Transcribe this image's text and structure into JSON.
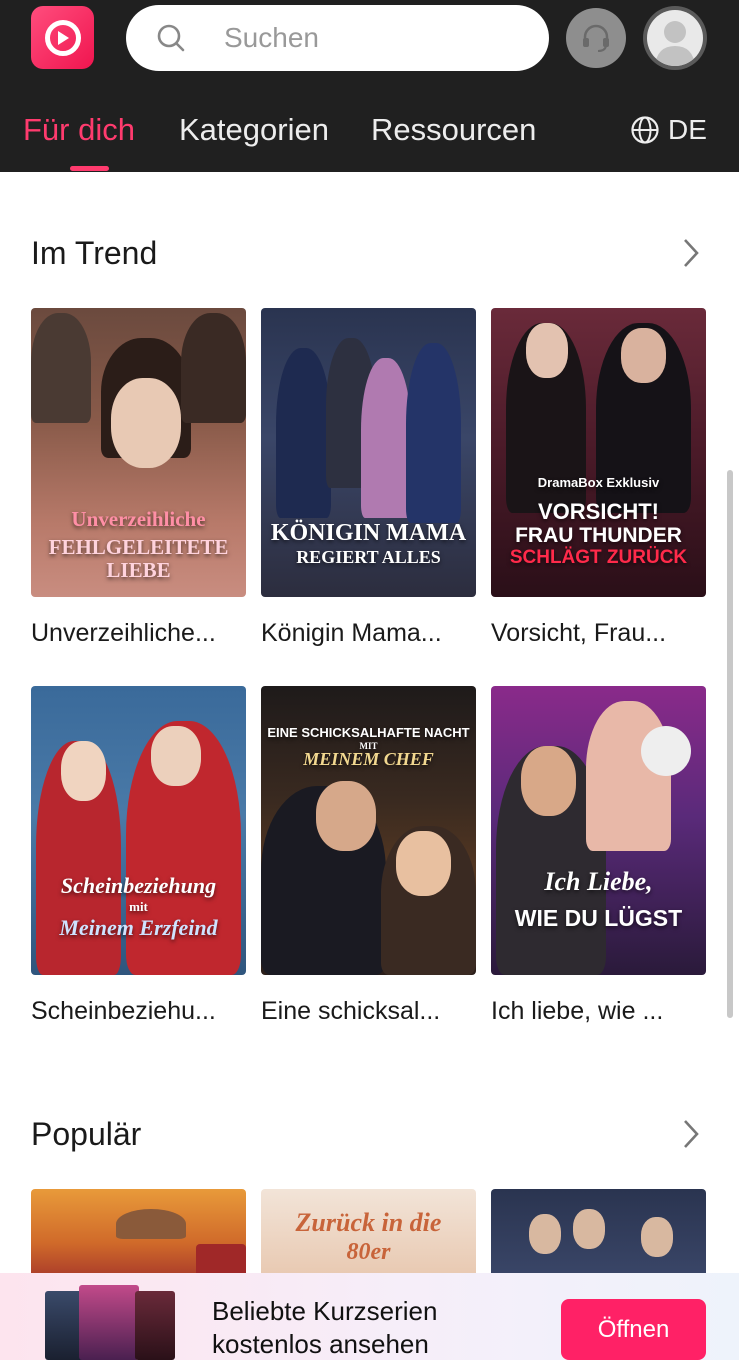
{
  "header": {
    "search_placeholder": "Suchen",
    "nav_tabs": [
      {
        "label": "Für dich",
        "active": true
      },
      {
        "label": "Kategorien",
        "active": false
      },
      {
        "label": "Ressourcen",
        "active": false
      }
    ],
    "language": "DE"
  },
  "colors": {
    "brand": "#ff3b6e",
    "header_bg": "#202020",
    "button": "#ff2166"
  },
  "trending": {
    "title": "Im Trend",
    "items": [
      {
        "title": "Unverzeihliche...",
        "poster_line1": "Unverzeihliche",
        "poster_line2": "FEHLGELEITETE LIEBE"
      },
      {
        "title": "Königin Mama...",
        "poster_line1": "KÖNIGIN MAMA",
        "poster_line2": "REGIERT ALLES"
      },
      {
        "title": "Vorsicht, Frau...",
        "poster_badge": "DramaBox Exklusiv",
        "poster_line1": "VORSICHT!",
        "poster_line2": "FRAU THUNDER",
        "poster_line3": "SCHLÄGT ZURÜCK"
      },
      {
        "title": "Scheinbeziehu...",
        "poster_line1": "Scheinbeziehung",
        "poster_line2": "mit",
        "poster_line3": "Meinem Erzfeind"
      },
      {
        "title": "Eine schicksal...",
        "poster_line1": "EINE SCHICKSALHAFTE NACHT",
        "poster_line2": "MIT",
        "poster_line3": "MEINEM CHEF"
      },
      {
        "title": "Ich liebe, wie ...",
        "poster_line1": "Ich Liebe,",
        "poster_line2": "WIE DU LÜGST"
      }
    ]
  },
  "popular": {
    "title": "Populär",
    "items": [
      {
        "poster_line1": ""
      },
      {
        "poster_line1": "Zurück in die",
        "poster_line2": "80er"
      },
      {
        "poster_line1": ""
      }
    ]
  },
  "banner": {
    "line1": "Beliebte Kurzserien",
    "line2": "kostenlos ansehen",
    "button": "Öffnen"
  }
}
